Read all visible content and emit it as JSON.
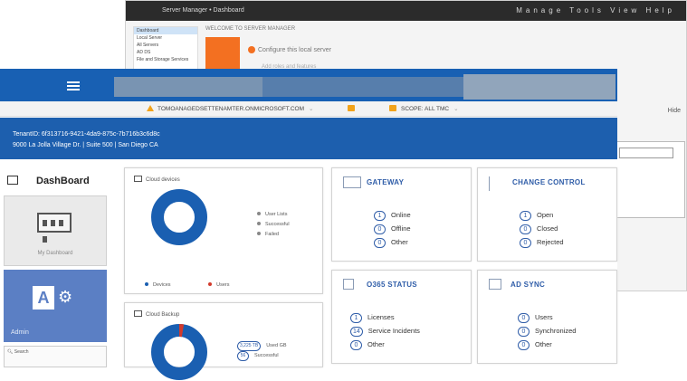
{
  "background_window": {
    "title": "Server Manager • Dashboard",
    "controls": "Manage Tools View Help",
    "header": "WELCOME TO SERVER MANAGER",
    "quick_start": "Configure this local server",
    "roles_text": "Add roles and features",
    "sidebar": [
      "Dashboard",
      "Local Server",
      "All Servers",
      "AD DS",
      "File and Storage Services"
    ],
    "corner_control": "Hide"
  },
  "topbar": {
    "menu_icon": "hamburger-icon"
  },
  "subbar": {
    "tenant_warning": "TOMOANAGEDSETTENAMTER.ONMICROSOFT.COM",
    "scope": "SCOPE: ALL TMC"
  },
  "tenant": {
    "line1": "TenantID: 6f313716-9421-4da9-875c-7b716b3c6d8c",
    "line2": "9000 La Jolla Village Dr. | Suite 500 | San Diego CA"
  },
  "nav": {
    "dashboard_heading": "DashBoard",
    "my_dashboard_label": "My Dashboard",
    "admin_label": "Admin",
    "search_label": "Search"
  },
  "cloud_devices": {
    "title": "Cloud devices",
    "legend": [
      "User Lists",
      "Successful",
      "Failed"
    ],
    "footer": [
      "Devices",
      "Users"
    ]
  },
  "cloud_backup": {
    "title": "Cloud Backup",
    "legend": [
      {
        "count": "3,225 TB",
        "label": "Used GB"
      },
      {
        "count": "56",
        "label": "Successful"
      }
    ]
  },
  "gateway": {
    "title": "GATEWAY",
    "rows": [
      {
        "count": "1",
        "label": "Online"
      },
      {
        "count": "0",
        "label": "Offline"
      },
      {
        "count": "0",
        "label": "Other"
      }
    ]
  },
  "change_control": {
    "title": "CHANGE CONTROL",
    "rows": [
      {
        "count": "1",
        "label": "Open"
      },
      {
        "count": "0",
        "label": "Closed"
      },
      {
        "count": "0",
        "label": "Rejected"
      }
    ]
  },
  "o365": {
    "title": "O365 STATUS",
    "rows": [
      {
        "count": "1",
        "label": "Licenses"
      },
      {
        "count": "14",
        "label": "Service Incidents"
      },
      {
        "count": "0",
        "label": "Other"
      }
    ]
  },
  "ad_sync": {
    "title": "AD SYNC",
    "rows": [
      {
        "count": "0",
        "label": "Users"
      },
      {
        "count": "0",
        "label": "Synchronized"
      },
      {
        "count": "0",
        "label": "Other"
      }
    ]
  },
  "colors": {
    "primary": "#1d5fae",
    "accent": "#2f5da8",
    "warning": "#f2a31a",
    "donut": "#1a5fb1",
    "legend_red": "#d23a2c"
  }
}
